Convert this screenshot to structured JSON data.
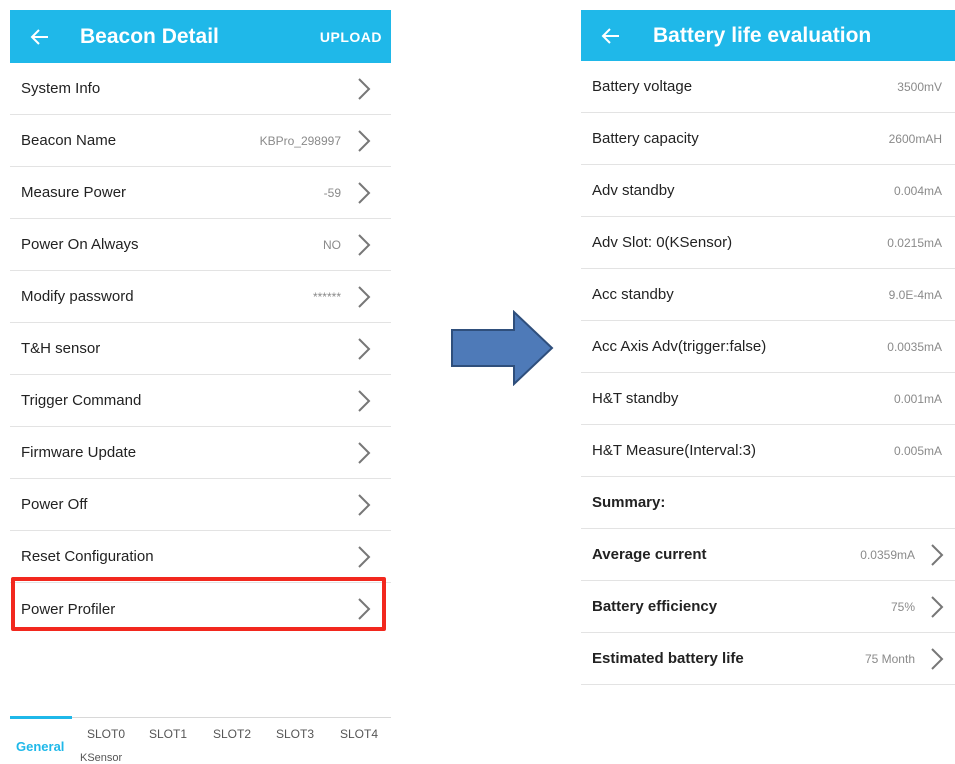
{
  "colors": {
    "accent": "#1fb8e9",
    "highlight": "#f2281e",
    "arrow_fill": "#4e7ab8",
    "arrow_stroke": "#2f4f7c"
  },
  "left": {
    "title": "Beacon Detail",
    "upload_label": "UPLOAD",
    "rows": [
      {
        "label": "System Info",
        "value": ""
      },
      {
        "label": "Beacon Name",
        "value": "KBPro_298997"
      },
      {
        "label": "Measure Power",
        "value": "-59"
      },
      {
        "label": "Power On Always",
        "value": "NO"
      },
      {
        "label": "Modify password",
        "value": "******"
      },
      {
        "label": "T&H sensor",
        "value": ""
      },
      {
        "label": "Trigger Command",
        "value": ""
      },
      {
        "label": "Firmware Update",
        "value": ""
      },
      {
        "label": "Power Off",
        "value": ""
      },
      {
        "label": "Reset Configuration",
        "value": ""
      },
      {
        "label": "Power Profiler",
        "value": ""
      }
    ],
    "tabs": [
      {
        "label": "General",
        "sublabel": ""
      },
      {
        "label": "SLOT0",
        "sublabel": "KSensor"
      },
      {
        "label": "SLOT1",
        "sublabel": ""
      },
      {
        "label": "SLOT2",
        "sublabel": ""
      },
      {
        "label": "SLOT3",
        "sublabel": ""
      },
      {
        "label": "SLOT4",
        "sublabel": ""
      }
    ]
  },
  "right": {
    "title": "Battery life evaluation",
    "rows": [
      {
        "label": "Battery voltage",
        "value": "3500mV"
      },
      {
        "label": "Battery capacity",
        "value": "2600mAH"
      },
      {
        "label": "Adv standby",
        "value": "0.004mA"
      },
      {
        "label": "Adv Slot: 0(KSensor)",
        "value": "0.0215mA"
      },
      {
        "label": "Acc standby",
        "value": "9.0E-4mA"
      },
      {
        "label": "Acc Axis Adv(trigger:false)",
        "value": "0.0035mA"
      },
      {
        "label": "H&T standby",
        "value": "0.001mA"
      },
      {
        "label": "H&T Measure(Interval:3)",
        "value": "0.005mA"
      },
      {
        "label": "Summary:",
        "value": ""
      },
      {
        "label": "Average current",
        "value": "0.0359mA"
      },
      {
        "label": "Battery efficiency",
        "value": "75%"
      },
      {
        "label": "Estimated battery life",
        "value": "75 Month"
      }
    ]
  }
}
